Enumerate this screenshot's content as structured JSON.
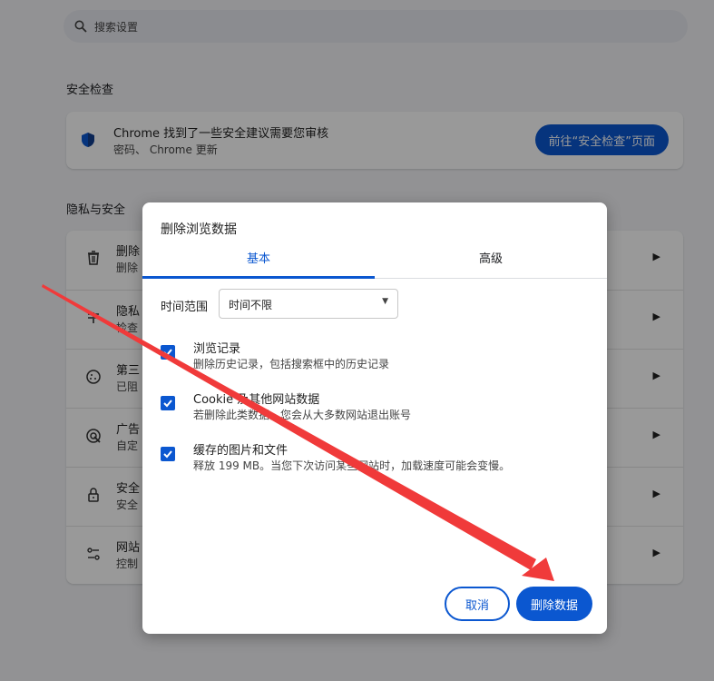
{
  "search": {
    "placeholder": "搜索设置"
  },
  "safety_check": {
    "heading": "安全检查",
    "title": "Chrome 找到了一些安全建议需要您审核",
    "subtitle": "密码、 Chrome 更新",
    "button": "前往“安全检查”页面"
  },
  "privacy": {
    "heading": "隐私与安全",
    "rows": [
      {
        "title": "删除",
        "subtitle": "删除",
        "icon": "trash-icon"
      },
      {
        "title": "隐私",
        "subtitle": "检查",
        "icon": "privacy-guide-icon"
      },
      {
        "title": "第三",
        "subtitle": "已阻",
        "icon": "cookie-icon"
      },
      {
        "title": "广告",
        "subtitle": "自定",
        "icon": "ad-privacy-icon"
      },
      {
        "title": "安全",
        "subtitle": "安全",
        "icon": "lock-icon"
      },
      {
        "title": "网站",
        "subtitle": "控制",
        "icon": "tune-icon"
      }
    ]
  },
  "dialog": {
    "title": "删除浏览数据",
    "tabs": {
      "basic": "基本",
      "advanced": "高级"
    },
    "time_range_label": "时间范围",
    "time_range_value": "时间不限",
    "options": [
      {
        "title": "浏览记录",
        "desc": "删除历史记录，包括搜索框中的历史记录",
        "checked": true
      },
      {
        "title": "Cookie 及其他网站数据",
        "desc": "若删除此类数据，您会从大多数网站退出账号",
        "checked": true
      },
      {
        "title": "缓存的图片和文件",
        "desc": "释放 199 MB。当您下次访问某些网站时，加载速度可能会变慢。",
        "checked": true
      }
    ],
    "cancel": "取消",
    "delete": "删除数据"
  },
  "colors": {
    "accent": "#0b57d0",
    "annotation_arrow": "#f03a3a"
  }
}
